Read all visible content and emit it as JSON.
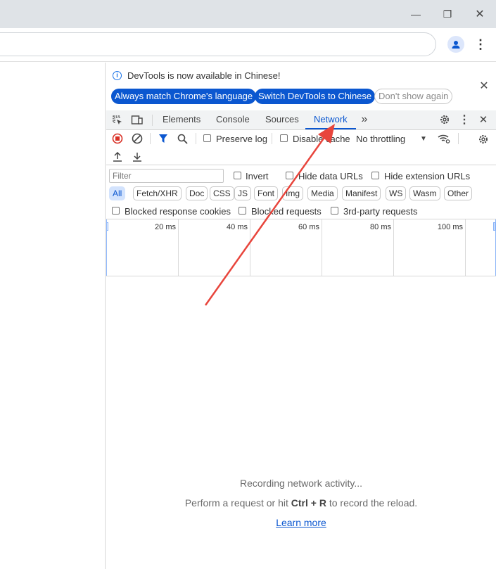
{
  "browser": {
    "window_controls": [
      "minimize",
      "restore",
      "close"
    ]
  },
  "devtools": {
    "infobar": {
      "message": "DevTools is now available in Chinese!",
      "buttons": [
        "Always match Chrome's language",
        "Switch DevTools to Chinese",
        "Don't show again"
      ]
    },
    "tabs": [
      "Elements",
      "Console",
      "Sources",
      "Network"
    ],
    "active_tab": "Network",
    "network": {
      "preserve_log": "Preserve log",
      "disable_cache": "Disable cache",
      "throttling": "No throttling",
      "filter_placeholder": "Filter",
      "invert": "Invert",
      "hide_data_urls": "Hide data URLs",
      "hide_extension_urls": "Hide extension URLs",
      "type_filters": [
        "All",
        "Fetch/XHR",
        "Doc",
        "CSS",
        "JS",
        "Font",
        "Img",
        "Media",
        "Manifest",
        "WS",
        "Wasm",
        "Other"
      ],
      "blocked_response_cookies": "Blocked response cookies",
      "blocked_requests": "Blocked requests",
      "third_party_requests": "3rd-party requests",
      "timeline_ticks": [
        "20 ms",
        "40 ms",
        "60 ms",
        "80 ms",
        "100 ms"
      ],
      "empty_title": "Recording network activity...",
      "empty_hint_pre": "Perform a request or hit",
      "empty_hint_keys": "Ctrl + R",
      "empty_hint_post": "to record the reload.",
      "learn_more": "Learn more"
    }
  },
  "colors": {
    "accent": "#0b57d0",
    "annotation_arrow": "#e8453c"
  }
}
